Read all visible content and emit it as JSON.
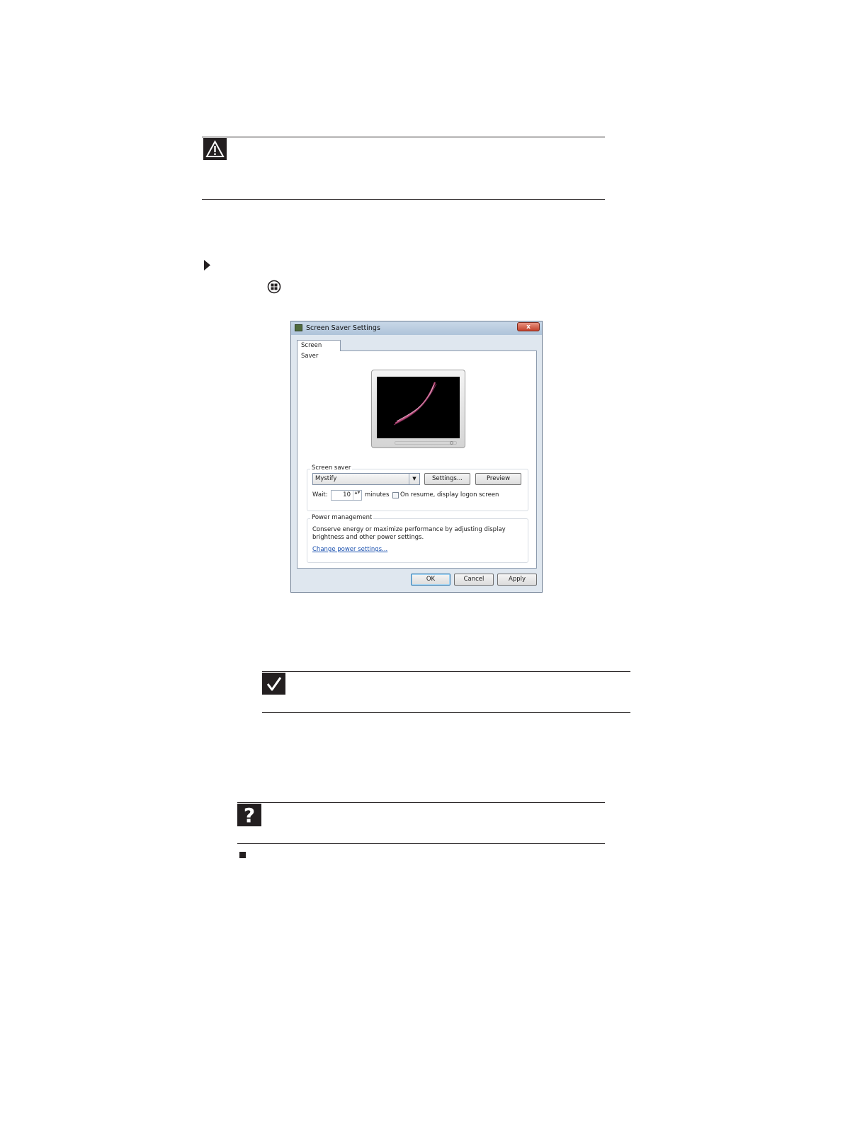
{
  "icons": {
    "caution": "warning-triangle-icon",
    "arrow": "right-triangle-bullet",
    "start": "windows-start-icon",
    "important": "checkmark-icon",
    "help": "question-mark-icon",
    "end": "square-end-mark"
  },
  "dialog": {
    "title": "Screen Saver Settings",
    "close_label": "x",
    "tab_label": "Screen Saver",
    "screen_saver_group_label": "Screen saver",
    "screen_saver_value": "Mystify",
    "combo_arrow": "▼",
    "settings_button": "Settings...",
    "preview_button": "Preview",
    "wait_label": "Wait:",
    "wait_value": "10",
    "spin_arrows": "▲▼",
    "minutes_label": "minutes",
    "resume_label": "On resume, display logon screen",
    "power_group_label": "Power management",
    "power_description": "Conserve energy or maximize performance by adjusting display brightness and other power settings.",
    "power_link": "Change power settings...",
    "ok_button": "OK",
    "cancel_button": "Cancel",
    "apply_button": "Apply"
  },
  "colors": {
    "page_background": "#ffffff",
    "rule_color": "#231f20",
    "dialog_background": "#dfe7ef",
    "link_color": "#1c52b0"
  }
}
